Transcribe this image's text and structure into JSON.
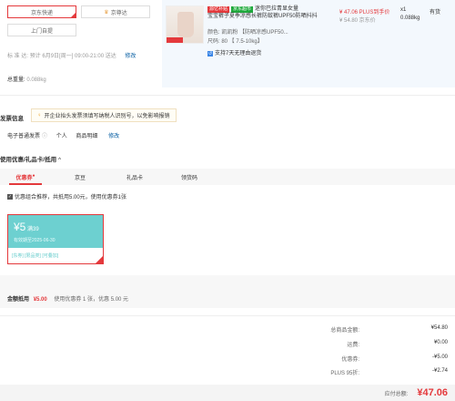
{
  "delivery": {
    "option_jd": "京东快递",
    "option_express": "京尊达",
    "option_pickup": "上门自提",
    "standard_label": "标 准 达:",
    "standard_time": "预计 6月9日[周一] 09:00-21:00 送达",
    "modify": "修改",
    "weight_label": "总重量:",
    "weight_value": "0.088kg"
  },
  "product": {
    "tag_badge": "源亿补贴",
    "tag_market": "京东超市",
    "title_1": "迷你巴拉青显女量",
    "title_2": "宝宝裤子夏季凉感长裤防蚊裤UPF50防晒抖抖",
    "color_line": "颜色: 凯凯粉 【防晒凉感UPF50...",
    "size_line": "尺码: 80 【 7.5-10kg】",
    "return_note": "支持7天无理由退货",
    "price": "¥ 47.06 PLUS到手价",
    "price_orig": "¥ 54.80 京东价",
    "qty": "x1",
    "stock": "有货",
    "weight": "0.088kg"
  },
  "invoice": {
    "section_title": "发票信息",
    "hint": "开企业抬头发票须填写纳税人识别号，以免影响报销",
    "type": "电子普通发票",
    "person": "个人",
    "detail": "商品明细",
    "modify": "修改"
  },
  "coupons": {
    "section_title": "使用优惠/礼品卡/抵用",
    "caret": "^",
    "tabs": [
      "优惠券",
      "京豆",
      "礼品卡",
      "领货码"
    ],
    "recommend": "优惠组合推荐，共抵用5.00元，使用优惠券1张",
    "card_amount": "¥5",
    "card_condition": "满39",
    "card_expire": "有效期至2025-06-30",
    "card_tags": "[东券] [限品类] [可叠加]"
  },
  "discount_bar": {
    "label": "金额抵用",
    "amount": "¥5.00",
    "detail": "使用优惠券 1 张，优惠 5.00 元"
  },
  "summary": {
    "rows": [
      {
        "label": "总商品金额:",
        "value": "¥54.80"
      },
      {
        "label": "运费:",
        "value": "¥0.00"
      },
      {
        "label": "优惠券:",
        "value": "-¥5.00"
      },
      {
        "label": "PLUS 95折:",
        "value": "-¥2.74"
      }
    ],
    "total_label": "应付总额:",
    "total_value": "¥47.06"
  },
  "colors": {
    "brand_red": "#e4393c",
    "coupon_teal": "#6dd0d0",
    "panel_blue": "#f3f8fd"
  }
}
